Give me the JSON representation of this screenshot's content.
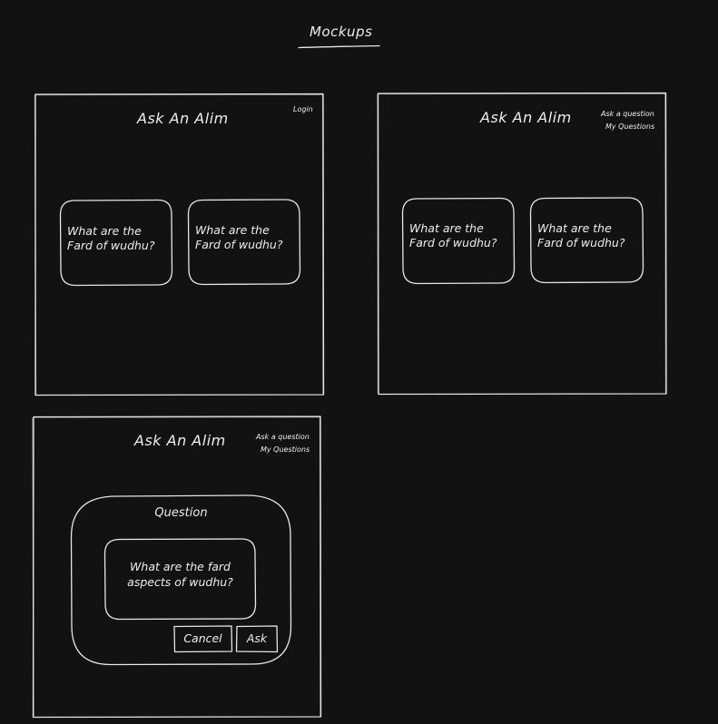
{
  "page_title": "Mockups",
  "colors": {
    "background": "#121212",
    "stroke": "#e6e6e6",
    "text": "#ededed"
  },
  "mockup1": {
    "app_title": "Ask An Alim",
    "nav": {
      "login": "Login"
    },
    "cards": [
      {
        "line1": "What are the",
        "line2": "Fard of wudhu?"
      },
      {
        "line1": "What are the",
        "line2": "Fard of wudhu?"
      }
    ]
  },
  "mockup2": {
    "app_title": "Ask An Alim",
    "nav": {
      "ask_question": "Ask a question",
      "my_questions": "My Questions"
    },
    "cards": [
      {
        "line1": "What are the",
        "line2": "Fard of wudhu?"
      },
      {
        "line1": "What are the",
        "line2": "Fard of wudhu?"
      }
    ]
  },
  "mockup3": {
    "app_title": "Ask An Alim",
    "nav": {
      "ask_question": "Ask a question",
      "my_questions": "My Questions"
    },
    "dialog": {
      "title": "Question",
      "input_line1": "What are the fard",
      "input_line2": "aspects of wudhu?",
      "cancel_label": "Cancel",
      "ask_label": "Ask"
    }
  }
}
